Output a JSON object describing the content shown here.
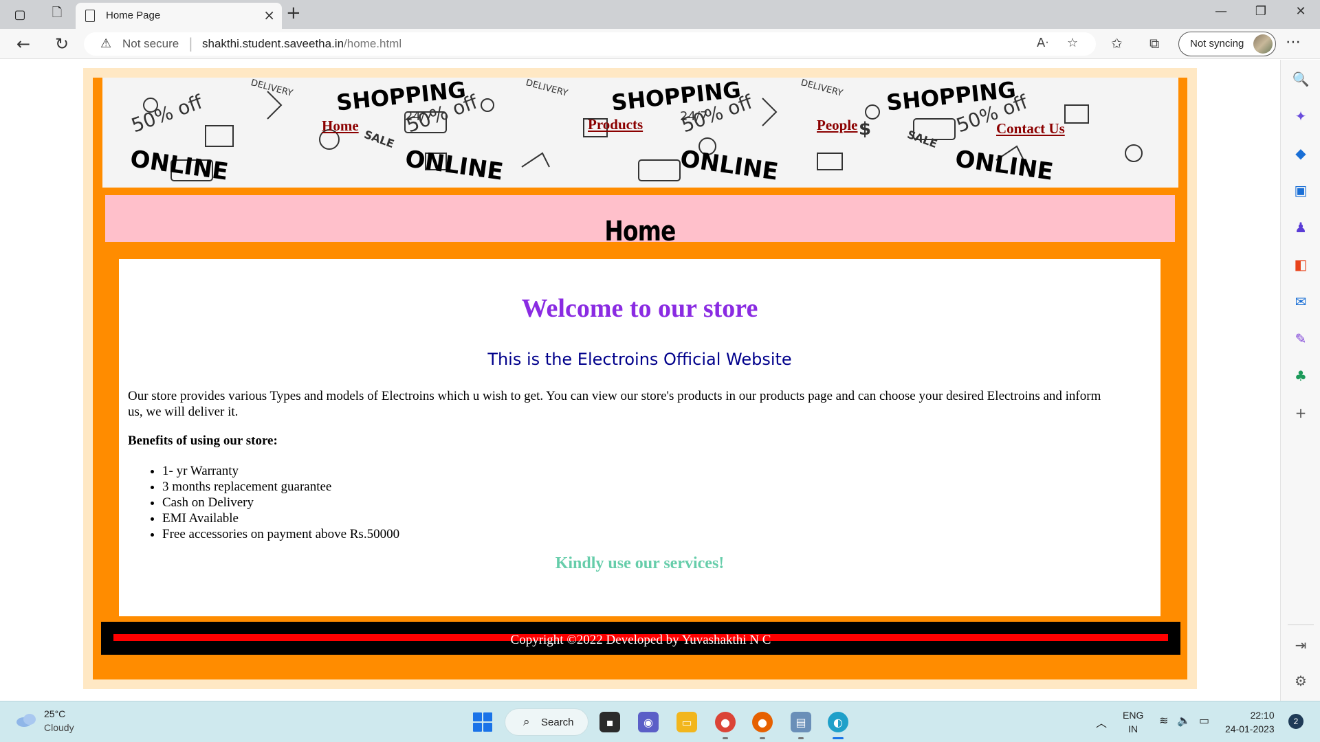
{
  "browser": {
    "tab_title": "Home Page",
    "security_label": "Not secure",
    "url_host": "shakthi.student.saveetha.in",
    "url_path": "/home.html",
    "sync_label": "Not syncing"
  },
  "banner": {
    "nav": [
      "Home",
      "Products",
      "People",
      "Contact Us"
    ],
    "words": [
      "SHOPPING",
      "ONLINE",
      "50% off",
      "DELIVERY",
      "24/7",
      "SALE",
      "$"
    ]
  },
  "page": {
    "heading": "Home",
    "welcome": "Welcome to our store",
    "subtitle": "This is the Electroins Official Website",
    "intro": "Our store provides various Types and models of Electroins which u wish to get. You can view our store's products in our products page and can choose your desired Electroins and inform us, we will deliver it.",
    "benefits_heading": "Benefits of using our store:",
    "benefits": [
      "1- yr Warranty",
      "3 months replacement guarantee",
      "Cash on Delivery",
      "EMI Available",
      "Free accessories on payment above Rs.50000"
    ],
    "closing": "Kindly use our services!",
    "footer": "Copyright ©2022 Developed by Yuvashakthi N C"
  },
  "colors": {
    "frame_outer": "#ffe8c4",
    "frame_inner": "#ff8c00",
    "heading_bar": "#ffc0cb",
    "nav_link": "#8b0000",
    "welcome": "#8a2be2",
    "subtitle": "#00008b",
    "closing": "#66cdaa",
    "footer_bg": "#000000",
    "footer_line": "#ff0000"
  },
  "taskbar": {
    "temperature": "25°C",
    "weather": "Cloudy",
    "search_label": "Search",
    "lang_1": "ENG",
    "lang_2": "IN",
    "time": "22:10",
    "date": "24-01-2023",
    "notification_count": "2"
  }
}
